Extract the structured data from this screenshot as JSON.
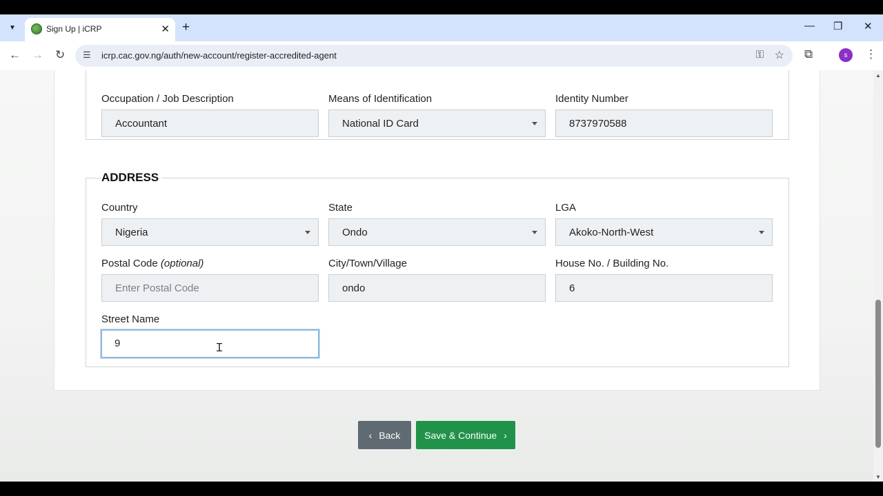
{
  "browser": {
    "tab_title": "Sign Up | iCRP",
    "url": "icrp.cac.gov.ng/auth/new-account/register-accredited-agent",
    "profile_initial": "s"
  },
  "identity": {
    "occupation": {
      "label": "Occupation / Job Description",
      "value": "Accountant"
    },
    "id_means": {
      "label": "Means of Identification",
      "value": "National ID Card"
    },
    "id_number": {
      "label": "Identity Number",
      "value": "8737970588"
    }
  },
  "address": {
    "legend": "ADDRESS",
    "country": {
      "label": "Country",
      "value": "Nigeria"
    },
    "state": {
      "label": "State",
      "value": "Ondo"
    },
    "lga": {
      "label": "LGA",
      "value": "Akoko-North-West"
    },
    "postal": {
      "label": "Postal Code",
      "label_suffix": "(optional)",
      "placeholder": "Enter Postal Code"
    },
    "city": {
      "label": "City/Town/Village",
      "value": "ondo"
    },
    "house": {
      "label": "House No. / Building No.",
      "value": "6"
    },
    "street": {
      "label": "Street Name",
      "value": "9"
    }
  },
  "actions": {
    "back_label": "Back",
    "save_label": "Save & Continue"
  },
  "icons": [
    "tab-search-icon",
    "favicon",
    "close-icon",
    "plus-icon",
    "minimize-icon",
    "restore-icon",
    "back-arrow-icon",
    "forward-arrow-icon",
    "reload-icon",
    "site-info-icon",
    "password-key-icon",
    "bookmark-star-icon",
    "extensions-icon",
    "kebab-menu-icon",
    "chevron-left-icon",
    "chevron-right-icon",
    "text-cursor-icon"
  ],
  "colors": {
    "save_button": "#21924a",
    "back_button": "#5f6a72",
    "tab_strip": "#d3e3fd",
    "profile": "#8c2fc7"
  }
}
